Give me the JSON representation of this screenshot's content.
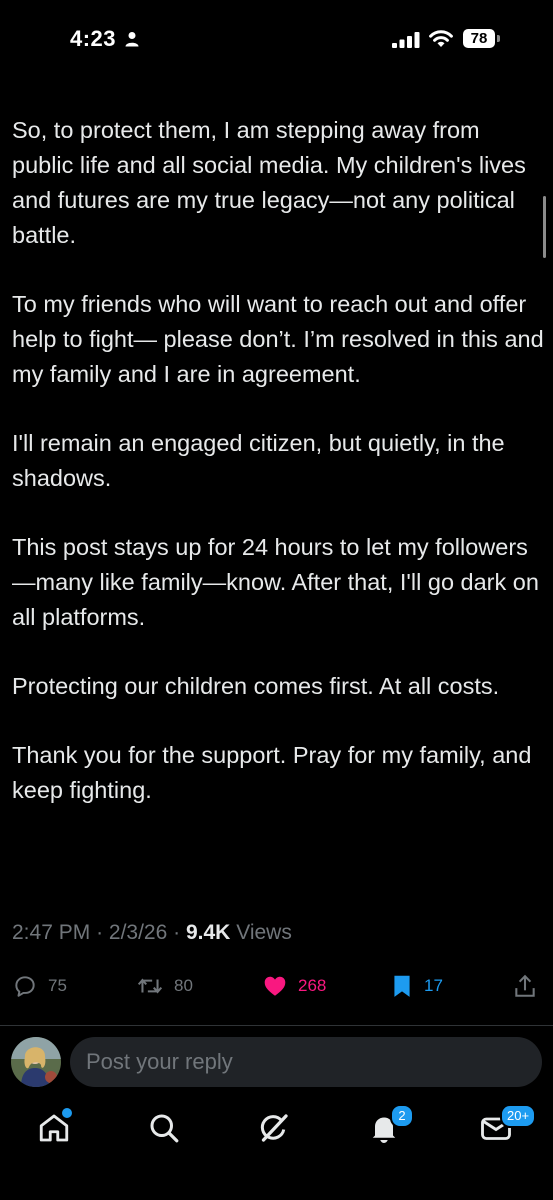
{
  "status_bar": {
    "time": "4:23",
    "battery": "78"
  },
  "post": {
    "paragraphs": [
      "So, to protect them, I am stepping away from public life and all social media. My children's lives and futures are my true legacy—not any political battle.",
      "To my friends who will want to reach out and offer help to fight— please don’t. I’m resolved in this and my family and I are in agreement.",
      "I'll remain an engaged citizen, but quietly, in the shadows.",
      "This post stays up for 24 hours to let my followers—many like family—know. After that, I'll go dark on all platforms.",
      "Protecting our children comes first. At all costs.",
      "Thank you for the support. Pray for my family, and keep fighting."
    ],
    "meta": {
      "time": "2:47 PM",
      "separator": "·",
      "date": "2/3/26",
      "views_count": "9.4K",
      "views_label": "Views"
    }
  },
  "actions": {
    "replies": "75",
    "reposts": "80",
    "likes": "268",
    "bookmarks": "17"
  },
  "reply_box": {
    "placeholder": "Post your reply"
  },
  "nav": {
    "notifications_badge": "2",
    "messages_badge": "20+"
  },
  "colors": {
    "background": "#000000",
    "text": "#e7e9ea",
    "muted": "#71767b",
    "like": "#f91880",
    "accent": "#1d9bf0"
  }
}
